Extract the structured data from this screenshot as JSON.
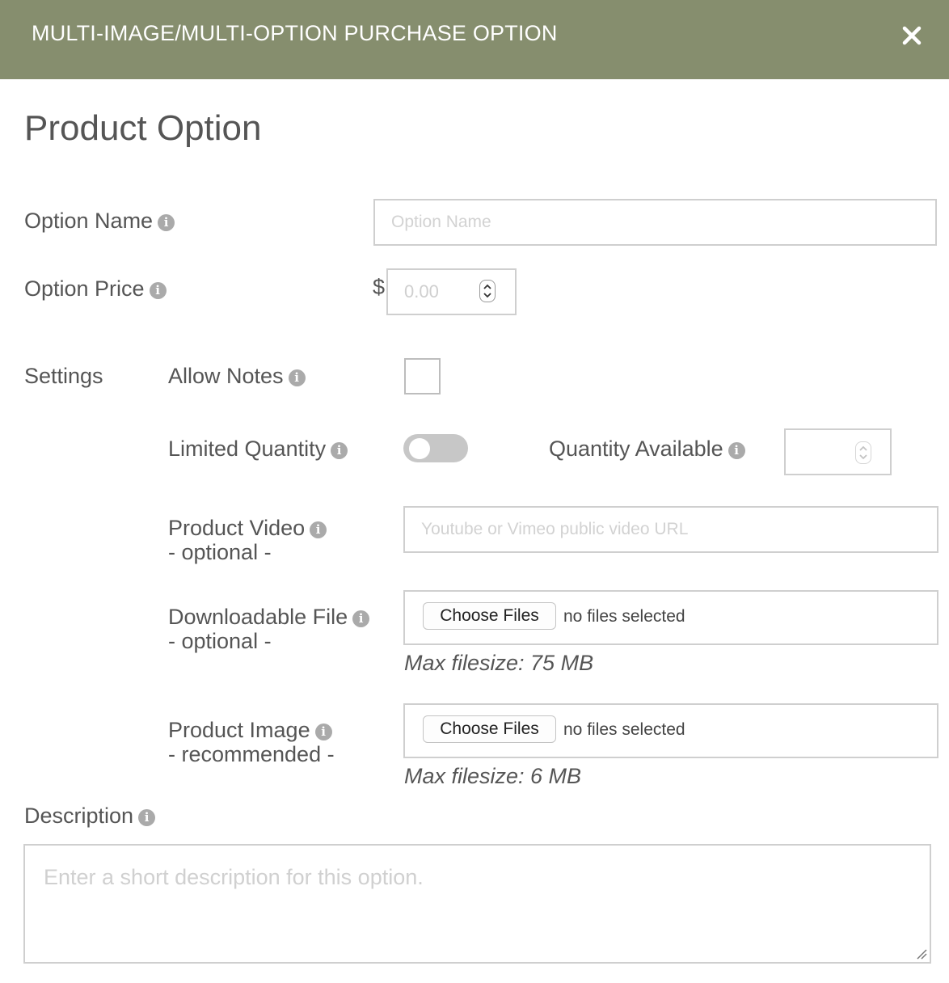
{
  "modal": {
    "title": "MULTI-IMAGE/MULTI-OPTION PURCHASE OPTION",
    "close_icon": "close-icon",
    "header_color": "#868e6e"
  },
  "form": {
    "heading": "Product Option",
    "option_name": {
      "label": "Option Name",
      "placeholder": "Option Name",
      "value": ""
    },
    "option_price": {
      "label": "Option Price",
      "currency": "$",
      "placeholder": "0.00"
    },
    "settings": {
      "label": "Settings",
      "allow_notes": {
        "label": "Allow Notes",
        "checked": false
      },
      "limited_quantity": {
        "label": "Limited Quantity",
        "enabled": false
      },
      "quantity_available": {
        "label": "Quantity Available",
        "value": ""
      },
      "product_video": {
        "label": "Product Video",
        "sub": "- optional -",
        "placeholder": "Youtube or Vimeo public video URL"
      },
      "downloadable_file": {
        "label": "Downloadable File",
        "sub": "- optional -",
        "button": "Choose Files",
        "status": "no files selected",
        "hint": "Max filesize: 75 MB"
      },
      "product_image": {
        "label": "Product Image",
        "sub": "- recommended -",
        "button": "Choose Files",
        "status": "no files selected",
        "hint": "Max filesize: 6 MB"
      }
    },
    "description": {
      "label": "Description",
      "placeholder": "Enter a short description for this option."
    }
  }
}
